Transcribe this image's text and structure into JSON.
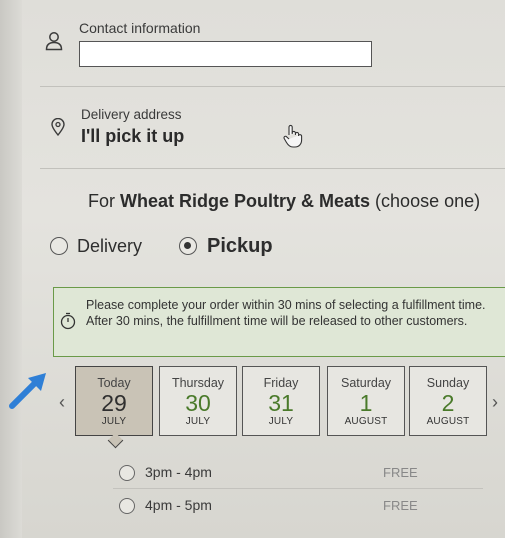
{
  "contact": {
    "label": "Contact information",
    "value": ""
  },
  "delivery_address": {
    "label": "Delivery address",
    "value": "I'll pick it up"
  },
  "store": {
    "prefix": "For ",
    "name": "Wheat Ridge Poultry & Meats",
    "suffix": " (choose one)"
  },
  "fulfillment_options": [
    {
      "label": "Delivery",
      "selected": false
    },
    {
      "label": "Pickup",
      "selected": true
    }
  ],
  "notice": "Please complete your order within 30 mins of selecting a fulfillment time. After 30 mins, the fulfillment time will be released to other customers.",
  "days": [
    {
      "name": "Today",
      "number": "29",
      "month": "JULY",
      "selected": true
    },
    {
      "name": "Thursday",
      "number": "30",
      "month": "JULY",
      "selected": false
    },
    {
      "name": "Friday",
      "number": "31",
      "month": "JULY",
      "selected": false
    },
    {
      "name": "Saturday",
      "number": "1",
      "month": "AUGUST",
      "selected": false
    },
    {
      "name": "Sunday",
      "number": "2",
      "month": "AUGUST",
      "selected": false
    }
  ],
  "time_slots": [
    {
      "label": "3pm - 4pm",
      "price": "FREE"
    },
    {
      "label": "4pm - 5pm",
      "price": "FREE"
    }
  ],
  "icons": {
    "contact": "person-icon",
    "address": "location-pin-icon",
    "notice": "timer-icon",
    "prev": "chevron-left-icon",
    "next": "chevron-right-icon",
    "cursor": "hand-pointer-icon"
  },
  "colors": {
    "accent_green": "#4a7a2a",
    "notice_border": "#6a9a48",
    "notice_bg": "#dfe7d6",
    "selected_day_bg": "#c9c3b6",
    "arrow_blue": "#2f7fd6"
  }
}
